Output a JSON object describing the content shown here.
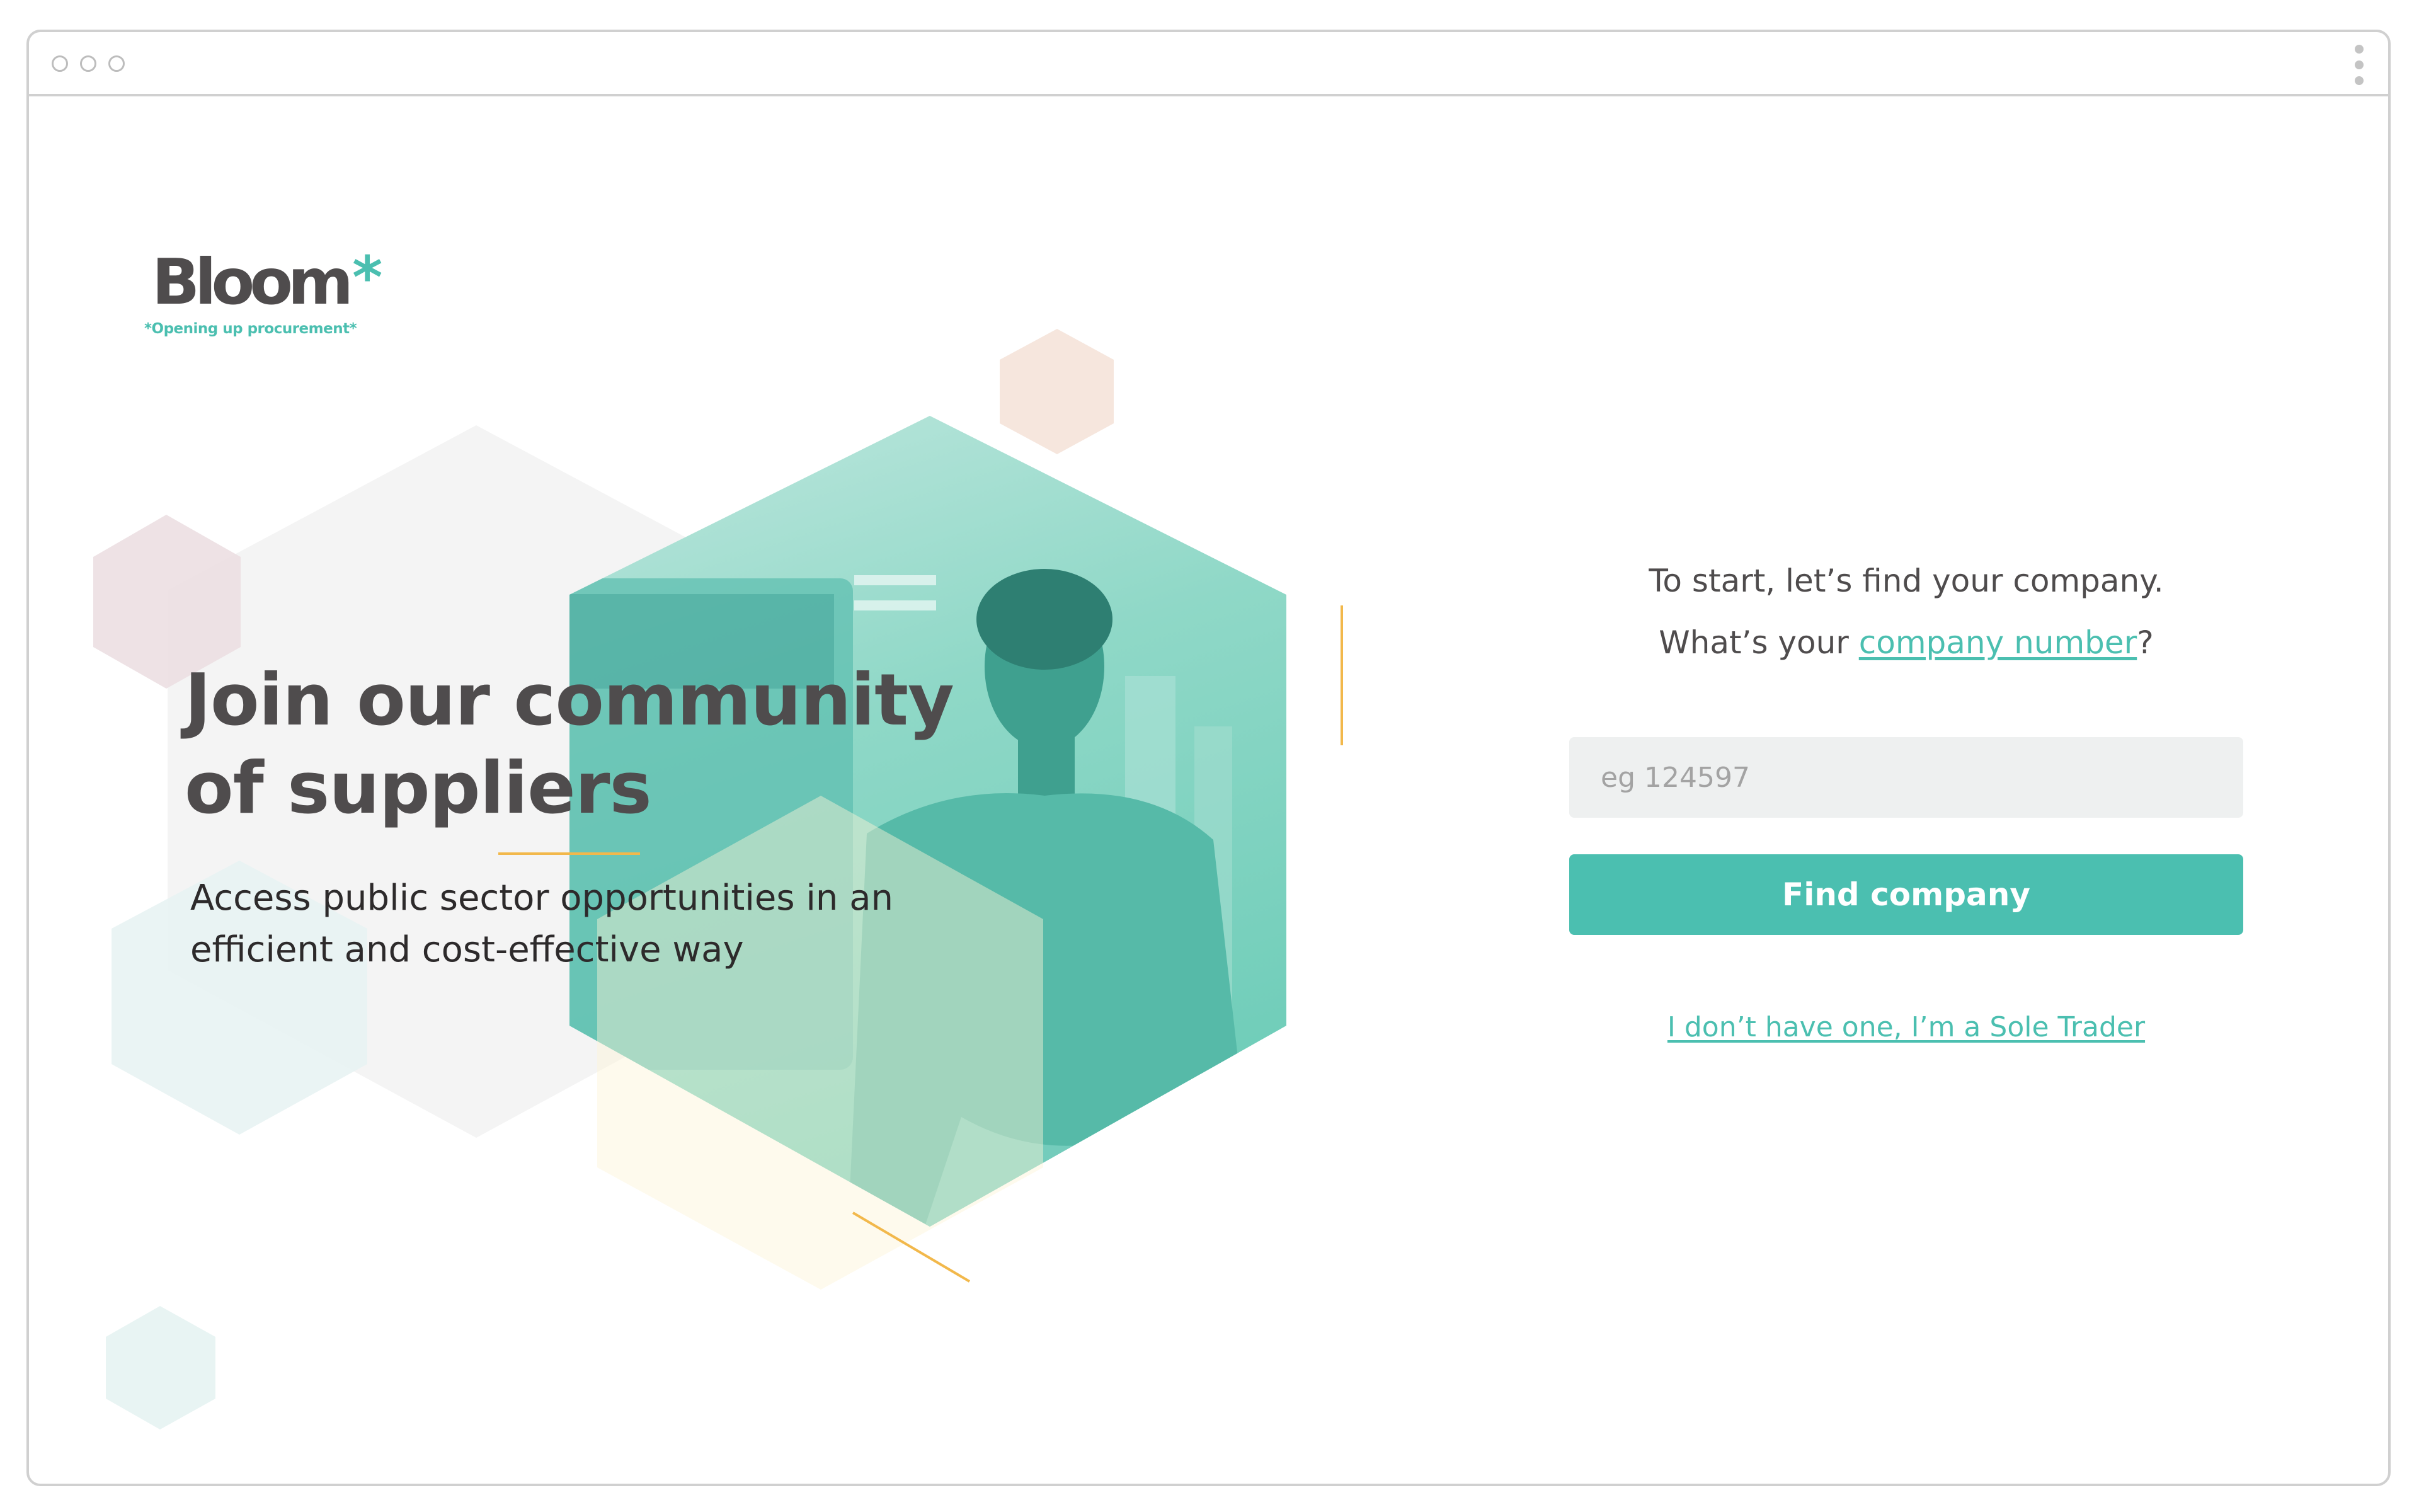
{
  "window": {
    "controls": [
      "window-dot-icon",
      "window-dot-icon",
      "window-dot-icon"
    ],
    "menu_icon": "kebab-menu-icon"
  },
  "logo": {
    "word": "Bloom",
    "star": "*",
    "tagline": "*Opening up procurement*"
  },
  "hero": {
    "headline_line1": "Join our community",
    "headline_line2": "of suppliers",
    "subtext_line1": "Access public sector opportunities in an",
    "subtext_line2": "efficient and cost-effective way"
  },
  "form": {
    "prompt_line1": "To start, let’s find your company.",
    "prompt_line2_prefix": "What’s your ",
    "prompt_line2_link": "company number",
    "prompt_line2_suffix": "?",
    "input_value": "",
    "input_placeholder": "eg 124597",
    "submit_label": "Find company",
    "sole_trader_link": "I don’t have one, I’m a Sole Trader"
  },
  "colors": {
    "brand_teal": "#4bbfb0",
    "text_dark": "#4f4c4d",
    "accent_yellow": "#f2b84b",
    "input_bg": "#eef0f0"
  }
}
